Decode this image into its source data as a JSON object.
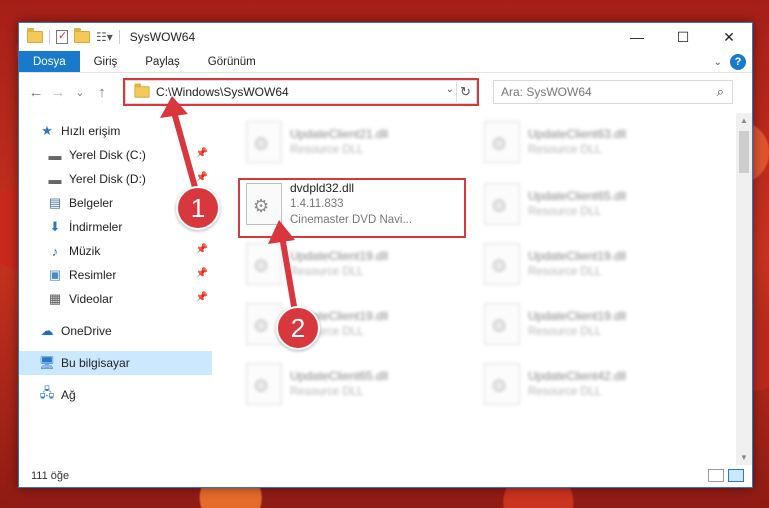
{
  "window": {
    "title": "SysWOW64",
    "controls": {
      "minimize": "—",
      "maximize": "☐",
      "close": "✕"
    }
  },
  "ribbon": {
    "tabs": [
      {
        "label": "Dosya",
        "active": true
      },
      {
        "label": "Giriş"
      },
      {
        "label": "Paylaş"
      },
      {
        "label": "Görünüm"
      }
    ],
    "help": "?"
  },
  "nav": {
    "back": "←",
    "forward": "→",
    "recent": "⌄",
    "up": "↑",
    "address": "C:\\Windows\\SysWOW64",
    "search_placeholder": "Ara: SysWOW64"
  },
  "sidebar": {
    "items": [
      {
        "label": "Hızlı erişim",
        "icon": "star-icon",
        "indent": false,
        "pinned": false
      },
      {
        "label": "Yerel Disk (C:)",
        "icon": "drive-icon",
        "indent": true,
        "pinned": true
      },
      {
        "label": "Yerel Disk (D:)",
        "icon": "drive-icon",
        "indent": true,
        "pinned": true
      },
      {
        "label": "Belgeler",
        "icon": "documents-icon",
        "indent": true,
        "pinned": true
      },
      {
        "label": "İndirmeler",
        "icon": "download-icon",
        "indent": true,
        "pinned": true
      },
      {
        "label": "Müzik",
        "icon": "music-icon",
        "indent": true,
        "pinned": true
      },
      {
        "label": "Resimler",
        "icon": "pictures-icon",
        "indent": true,
        "pinned": true
      },
      {
        "label": "Videolar",
        "icon": "videos-icon",
        "indent": true,
        "pinned": true
      },
      {
        "label": "OneDrive",
        "icon": "cloud-icon",
        "indent": false,
        "pinned": false
      },
      {
        "label": "Bu bilgisayar",
        "icon": "computer-icon",
        "indent": false,
        "pinned": false,
        "selected": true
      },
      {
        "label": "Ağ",
        "icon": "network-icon",
        "indent": false,
        "pinned": false
      }
    ]
  },
  "files": {
    "highlighted": {
      "name": "dvdpld32.dll",
      "version": "1.4.11.833",
      "description": "Cinemaster DVD Navi..."
    },
    "left_column": [
      {
        "name": "UpdateClient21.dll",
        "type": "Resource DLL"
      },
      {
        "name": "UpdateClient19.dll",
        "type": "Resource DLL"
      },
      {
        "name": "UpdateClient19.dll",
        "type": "Resource DLL"
      },
      {
        "name": "UpdateClient65.dll",
        "type": "Resource DLL"
      }
    ],
    "right_column": [
      {
        "name": "UpdateClient63.dll",
        "type": "Resource DLL"
      },
      {
        "name": "UpdateClient65.dll",
        "type": "Resource DLL"
      },
      {
        "name": "UpdateClient19.dll",
        "type": "Resource DLL"
      },
      {
        "name": "UpdateClient19.dll",
        "type": "Resource DLL"
      },
      {
        "name": "UpdateClient42.dll",
        "type": "Resource DLL"
      }
    ]
  },
  "status": {
    "item_count": "111 öğe"
  },
  "annotations": {
    "step1": "1",
    "step2": "2"
  },
  "colors": {
    "accent": "#1979ca",
    "highlight_red": "#d8373e"
  }
}
